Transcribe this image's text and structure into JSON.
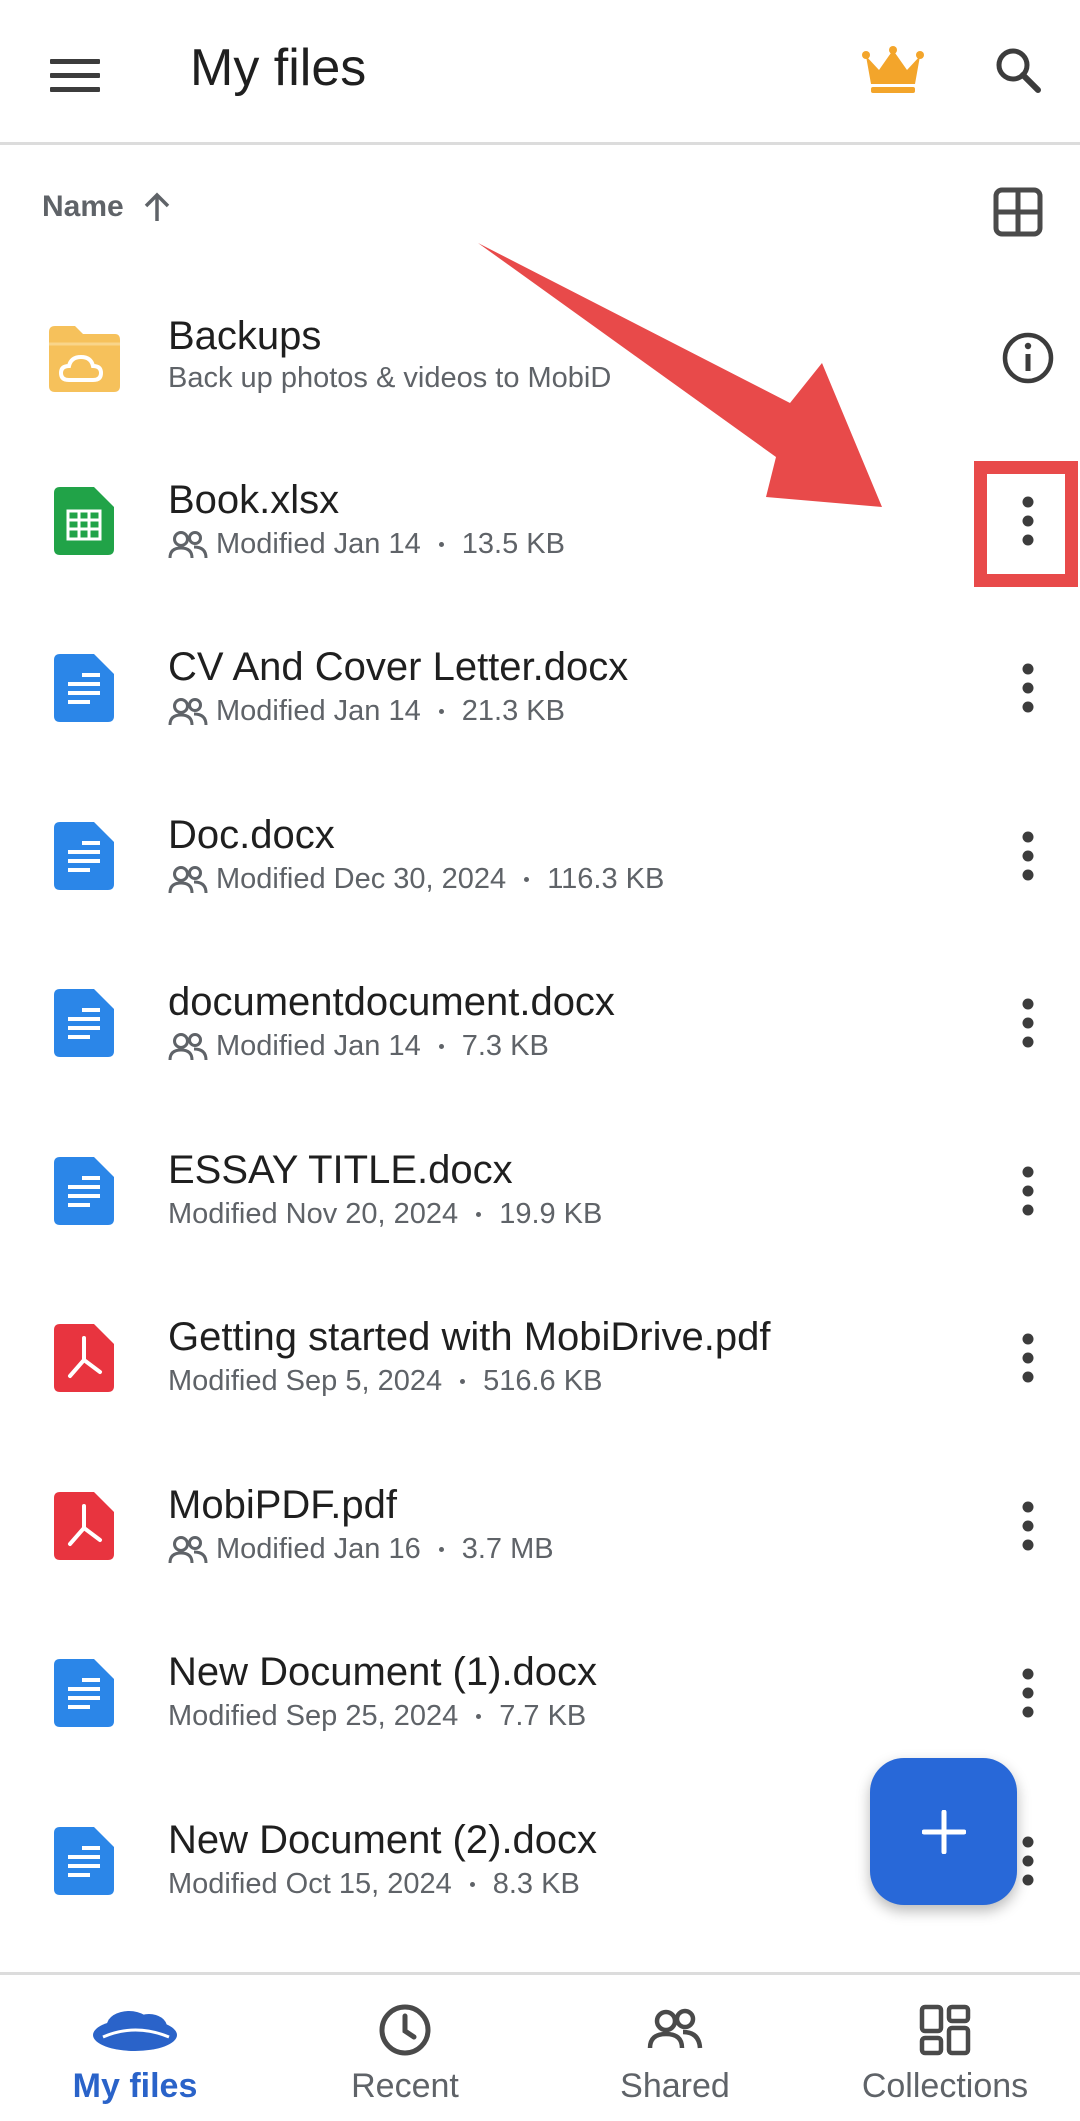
{
  "appbar": {
    "title": "My files",
    "icons": [
      "menu-icon",
      "crown-icon",
      "search-icon"
    ]
  },
  "sort": {
    "label": "Name",
    "direction": "ascending"
  },
  "files": [
    {
      "name": "Backups",
      "meta": "Back up photos & videos to MobiD",
      "type": "folder",
      "shared": false,
      "action": "info"
    },
    {
      "name": "Book.xlsx",
      "modified": "Modified Jan 14",
      "size": "13.5 KB",
      "type": "xlsx",
      "shared": true,
      "action": "more"
    },
    {
      "name": "CV And Cover Letter.docx",
      "modified": "Modified Jan 14",
      "size": "21.3 KB",
      "type": "docx",
      "shared": true,
      "action": "more"
    },
    {
      "name": "Doc.docx",
      "modified": "Modified Dec 30, 2024",
      "size": "116.3 KB",
      "type": "docx",
      "shared": true,
      "action": "more"
    },
    {
      "name": "documentdocument.docx",
      "modified": "Modified Jan 14",
      "size": "7.3 KB",
      "type": "docx",
      "shared": true,
      "action": "more"
    },
    {
      "name": "ESSAY TITLE.docx",
      "modified": "Modified Nov 20, 2024",
      "size": "19.9 KB",
      "type": "docx",
      "shared": false,
      "action": "more"
    },
    {
      "name": "Getting started with MobiDrive.pdf",
      "modified": "Modified Sep 5, 2024",
      "size": "516.6 KB",
      "type": "pdf",
      "shared": false,
      "action": "more"
    },
    {
      "name": "MobiPDF.pdf",
      "modified": "Modified Jan 16",
      "size": "3.7 MB",
      "type": "pdf",
      "shared": true,
      "action": "more"
    },
    {
      "name": "New Document (1).docx",
      "modified": "Modified Sep 25, 2024",
      "size": "7.7 KB",
      "type": "docx",
      "shared": false,
      "action": "more"
    },
    {
      "name": "New Document (2).docx",
      "modified": "Modified Oct 15, 2024",
      "size": "8.3 KB",
      "type": "docx",
      "shared": false,
      "action": "more"
    }
  ],
  "nav": [
    {
      "label": "My files",
      "icon": "cloud-icon",
      "active": true
    },
    {
      "label": "Recent",
      "icon": "clock-icon",
      "active": false
    },
    {
      "label": "Shared",
      "icon": "people-icon",
      "active": false
    },
    {
      "label": "Collections",
      "icon": "collections-icon",
      "active": false
    }
  ],
  "colors": {
    "accent": "#2868d8",
    "nav_active": "#2a63c9",
    "folder": "#f6c15b",
    "xlsx": "#21a348",
    "docx": "#2b86e8",
    "pdf": "#e8343f",
    "crown": "#f3a52b",
    "annotation": "#e84a4a"
  }
}
